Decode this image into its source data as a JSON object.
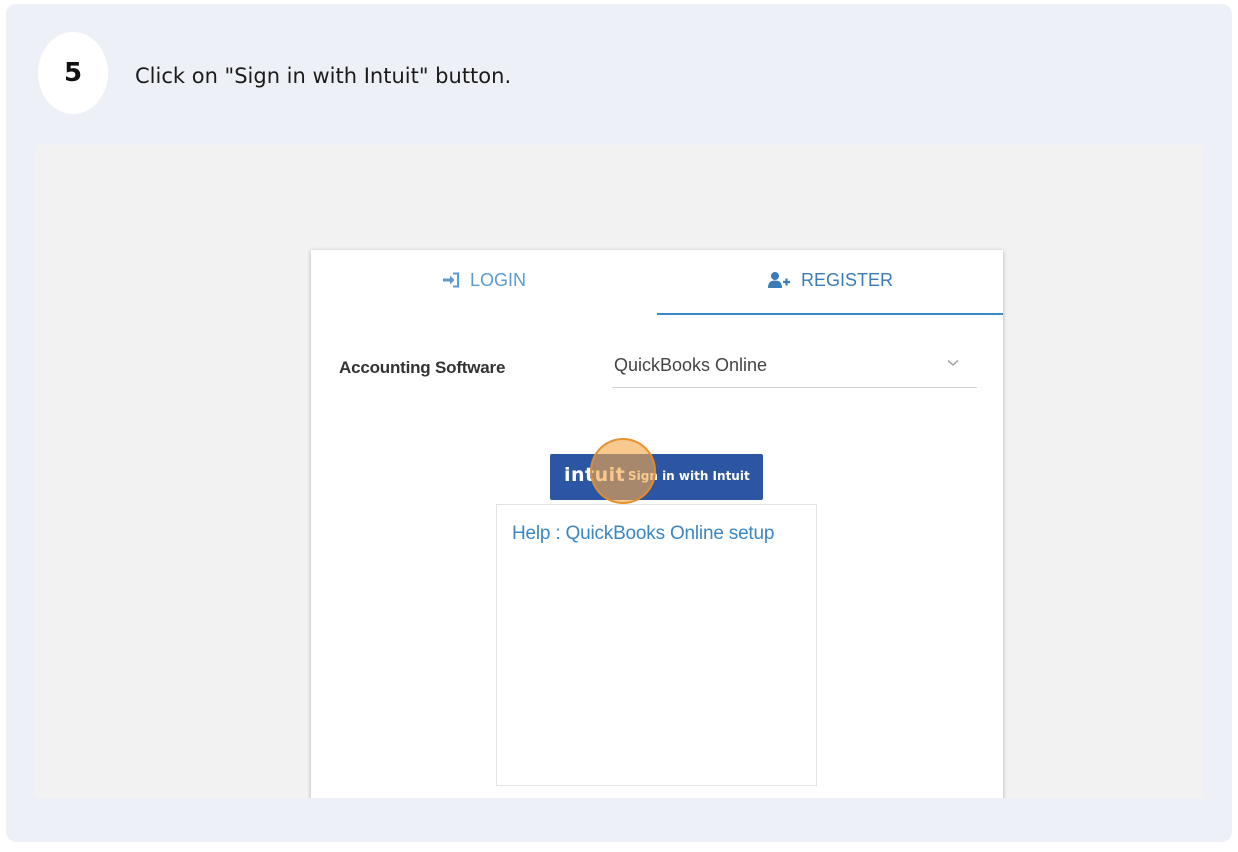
{
  "guide": {
    "step_number": "5",
    "instruction": "Click on \"Sign in with Intuit\" button."
  },
  "tabs": [
    {
      "label": "LOGIN",
      "icon": "sign-in-icon",
      "active": false
    },
    {
      "label": "REGISTER",
      "icon": "user-plus-icon",
      "active": true
    }
  ],
  "form": {
    "accounting_software_label": "Accounting Software",
    "accounting_software_value": "QuickBooks Online"
  },
  "intuit_button": {
    "logo_text": "intuit",
    "label": "Sign in with Intuit"
  },
  "help": {
    "link_text": "Help : QuickBooks Online setup"
  },
  "colors": {
    "card_background": "#eef0f8",
    "tab_accent": "#3a88c6",
    "intuit_blue": "#2c55a3",
    "click_highlight": "#f4a84a",
    "link_blue": "#3b87c5"
  }
}
